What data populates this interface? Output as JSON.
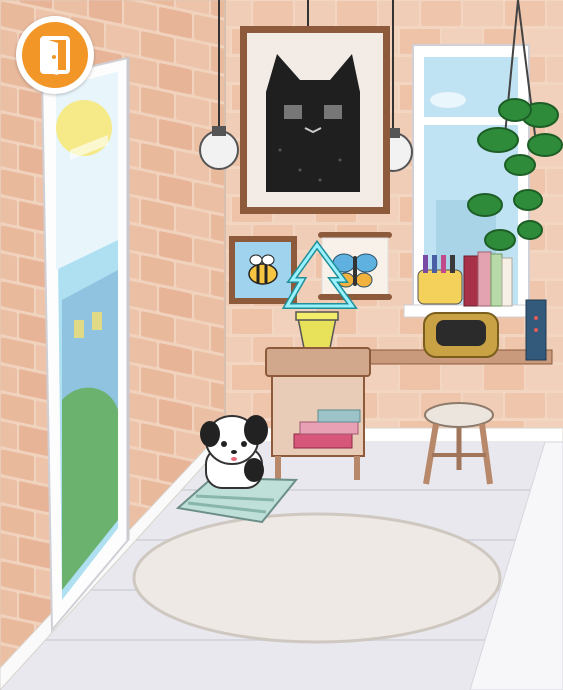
{
  "scene": {
    "name": "apartment-room",
    "colors": {
      "exit_button": "#f29628",
      "wall_brick": "#f0ccb4",
      "floor": "#e7e7ec",
      "wood": "#c99b7c",
      "sky": "#bfe3f2",
      "plant": "#2e8b3a"
    }
  },
  "controls": {
    "exit_button": {
      "icon": "door-exit-icon"
    }
  },
  "objects": [
    {
      "name": "glass-door",
      "icon": "door-icon"
    },
    {
      "name": "window",
      "icon": "window-icon"
    },
    {
      "name": "cat-poster",
      "icon": "cat-face-icon"
    },
    {
      "name": "bee-picture",
      "icon": "bee-icon"
    },
    {
      "name": "butterfly-poster",
      "icon": "butterfly-icon"
    },
    {
      "name": "hanging-plant",
      "icon": "plant-icon"
    },
    {
      "name": "neon-tree-lamp",
      "icon": "tree-icon"
    },
    {
      "name": "radio",
      "icon": "radio-icon"
    },
    {
      "name": "dog",
      "icon": "dog-icon"
    },
    {
      "name": "stool",
      "icon": "stool-icon"
    },
    {
      "name": "side-table",
      "icon": "table-icon"
    },
    {
      "name": "round-rug",
      "icon": "rug-icon"
    }
  ]
}
